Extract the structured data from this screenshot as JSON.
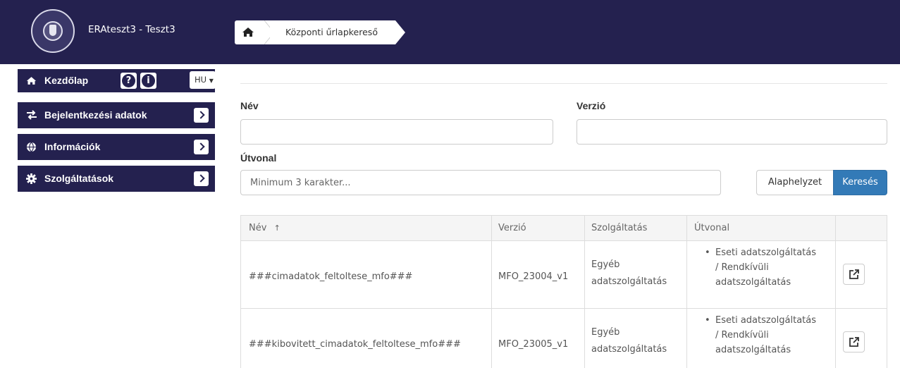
{
  "header": {
    "app_title": "ERAteszt3 - Teszt3",
    "breadcrumb": {
      "home_icon": "home-icon",
      "current": "Központi űrlapkereső"
    },
    "colors": {
      "header_bg": "#24214f",
      "primary": "#337ab7"
    }
  },
  "sidebar": {
    "home": {
      "label": "Kezdőlap",
      "icon": "home-icon",
      "help_icon": "question-icon",
      "info_icon": "info-icon",
      "lang": "HU"
    },
    "items": [
      {
        "label": "Bejelentkezési adatok",
        "icon": "exchange-icon"
      },
      {
        "label": "Információk",
        "icon": "globe-icon"
      },
      {
        "label": "Szolgáltatások",
        "icon": "gear-icon"
      }
    ]
  },
  "search": {
    "name_label": "Név",
    "name_value": "",
    "version_label": "Verzió",
    "version_value": "",
    "path_label": "Útvonal",
    "path_placeholder": "Minimum 3 karakter...",
    "reset_label": "Alaphelyzet",
    "search_label": "Keresés"
  },
  "table": {
    "columns": [
      "Név",
      "Verzió",
      "Szolgáltatás",
      "Útvonal",
      ""
    ],
    "sort_indicator": "↑",
    "rows": [
      {
        "name": "###cimadatok_feltoltese_mfo###",
        "version": "MFO_23004_v1",
        "service_line1": "Egyéb",
        "service_line2": "adatszolgáltatás",
        "path_line1": "Eseti adatszolgáltatás",
        "path_line2": "/ Rendkívüli",
        "path_line3": "adatszolgáltatás"
      },
      {
        "name": "###kibovitett_cimadatok_feltoltese_mfo###",
        "version": "MFO_23005_v1",
        "service_line1": "Egyéb",
        "service_line2": "adatszolgáltatás",
        "path_line1": "Eseti adatszolgáltatás",
        "path_line2": "/ Rendkívüli",
        "path_line3": "adatszolgáltatás"
      }
    ]
  }
}
